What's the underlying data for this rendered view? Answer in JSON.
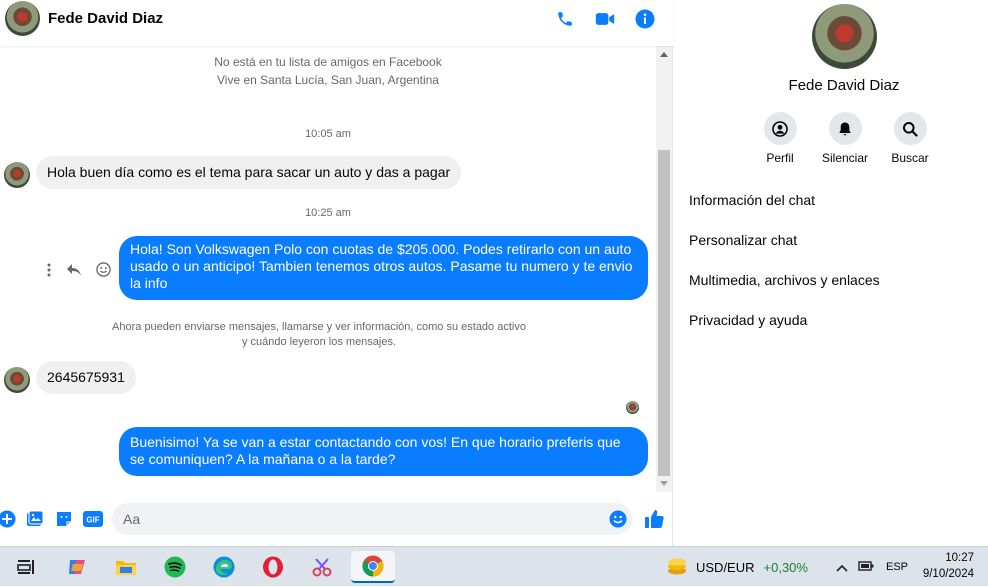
{
  "header": {
    "contact_name": "Fede David Diaz"
  },
  "conversation": {
    "intro_line1": "No está en tu lista de amigos en Facebook",
    "intro_line2": "Vive en Santa Lucía, San Juan, Argentina",
    "time1": "10:05 am",
    "msg1": "Hola buen día como es el tema para sacar un auto y das a pagar",
    "time2": "10:25 am",
    "msg2": "Hola! Son Volkswagen Polo con cuotas de $205.000. Podes retirarlo con un auto usado o un anticipo! Tambien tenemos otros autos. Pasame tu numero y te envio la info",
    "notice_line1": "Ahora pueden enviarse mensajes, llamarse y ver información, como su estado activo",
    "notice_line2": "y cuándo leyeron los mensajes.",
    "msg3": "2645675931",
    "msg4": "Buenisimo! Ya se van a estar contactando con vos! En que horario preferis que se comuniquen? A la mañana o a la tarde?"
  },
  "composer": {
    "placeholder": "Aa"
  },
  "info_panel": {
    "name": "Fede David Diaz",
    "actions": [
      {
        "label": "Perfil",
        "icon": "profile-icon"
      },
      {
        "label": "Silenciar",
        "icon": "bell-icon"
      },
      {
        "label": "Buscar",
        "icon": "search-icon"
      }
    ],
    "menu": [
      "Información del chat",
      "Personalizar chat",
      "Multimedia, archivos y enlaces",
      "Privacidad y ayuda"
    ]
  },
  "taskbar": {
    "ticker_label": "USD/EUR",
    "ticker_value": "+0,30%",
    "language": "ESP",
    "time": "10:27",
    "date": "9/10/2024"
  },
  "colors": {
    "accent": "#0a7cff",
    "positive": "#1a7f37"
  }
}
